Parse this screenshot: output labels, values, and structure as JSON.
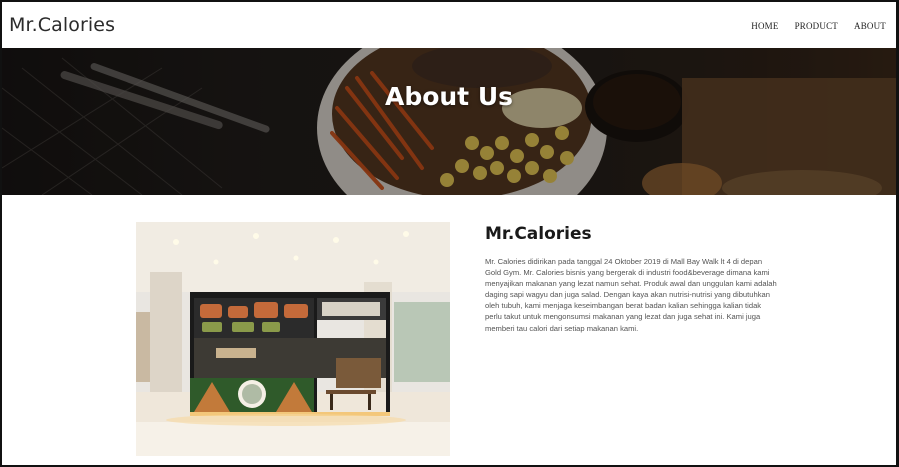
{
  "navbar": {
    "brand": "Mr.Calories",
    "links": [
      "HOME",
      "PRODUCT",
      "ABOUT"
    ]
  },
  "hero": {
    "title": "About Us"
  },
  "about": {
    "title": "Mr.Calories",
    "description": "Mr. Calories didirikan pada tanggal 24 Oktober 2019 di Mall Bay Walk lt 4 di depan Gold Gym. Mr. Calories bisnis yang bergerak di industri food&beverage dimana kami menyajikan makanan yang lezat namun sehat. Produk awal dan unggulan kami adalah daging sapi wagyu dan juga salad. Dengan kaya akan nutrisi-nutrisi yang dibutuhkan oleh tubuh, kami menjaga keseimbangan berat badan kalian sehingga kalian tidak perlu takut untuk mengonsumsi makanan yang lezat dan juga sehat ini. Kami juga memberi tau calori dari setiap makanan kami."
  }
}
